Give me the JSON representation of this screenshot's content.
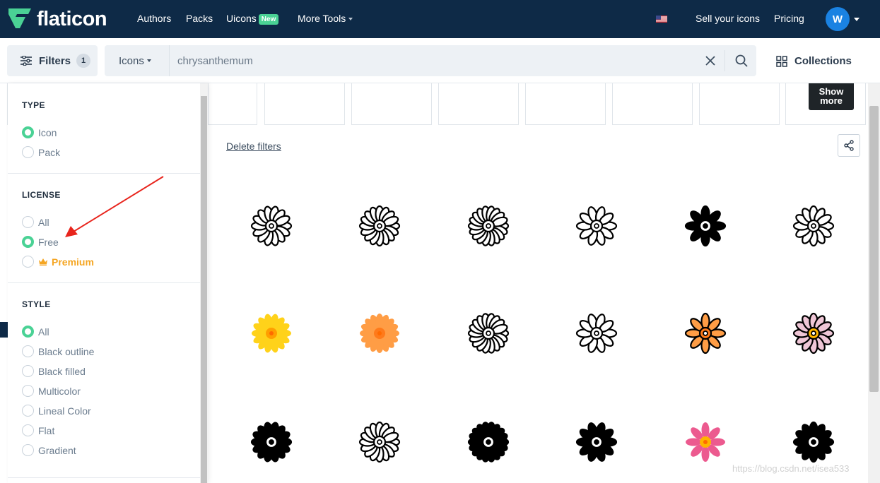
{
  "brand": {
    "name": "flaticon",
    "color": "#0e2a47",
    "accent": "#4ad295"
  },
  "nav": {
    "links": [
      "Authors",
      "Packs",
      "Uicons",
      "More Tools"
    ],
    "uicons_badge": "New",
    "sell": "Sell your icons",
    "pricing": "Pricing",
    "avatar_letter": "W"
  },
  "search": {
    "filters_label": "Filters",
    "filters_count": "1",
    "type_select": "Icons",
    "query": "chrysanthemum",
    "collections_label": "Collections"
  },
  "filters": {
    "type": {
      "title": "TYPE",
      "options": [
        "Icon",
        "Pack"
      ],
      "selected": "Icon"
    },
    "license": {
      "title": "LICENSE",
      "options": [
        "All",
        "Free",
        "Premium"
      ],
      "selected": "Free"
    },
    "style": {
      "title": "STYLE",
      "options": [
        "All",
        "Black outline",
        "Black filled",
        "Multicolor",
        "Lineal Color",
        "Flat",
        "Gradient"
      ],
      "selected": "All"
    }
  },
  "results": {
    "show_more": "Show more",
    "delete_filters": "Delete filters",
    "icons": [
      "chrysanthemum-outline-icon-1",
      "chrysanthemum-outline-icon-2",
      "chrysanthemum-outline-icon-3",
      "chrysanthemum-outline-icon-4",
      "chrysanthemum-filled-icon-5",
      "chrysanthemum-outline-icon-6",
      "chrysanthemum-yellow-icon-7",
      "chrysanthemum-orange-icon-8",
      "chrysanthemum-outline-icon-9",
      "chrysanthemum-outline-icon-10",
      "chrysanthemum-orange-icon-11",
      "chrysanthemum-pink-icon-12",
      "chrysanthemum-filled-icon-13",
      "chrysanthemum-outline-icon-14",
      "chrysanthemum-filled-icon-15",
      "chrysanthemum-filled-icon-16",
      "chrysanthemum-pink-icon-17",
      "chrysanthemum-filled-icon-18"
    ]
  },
  "watermark": "https://blog.csdn.net/isea533"
}
